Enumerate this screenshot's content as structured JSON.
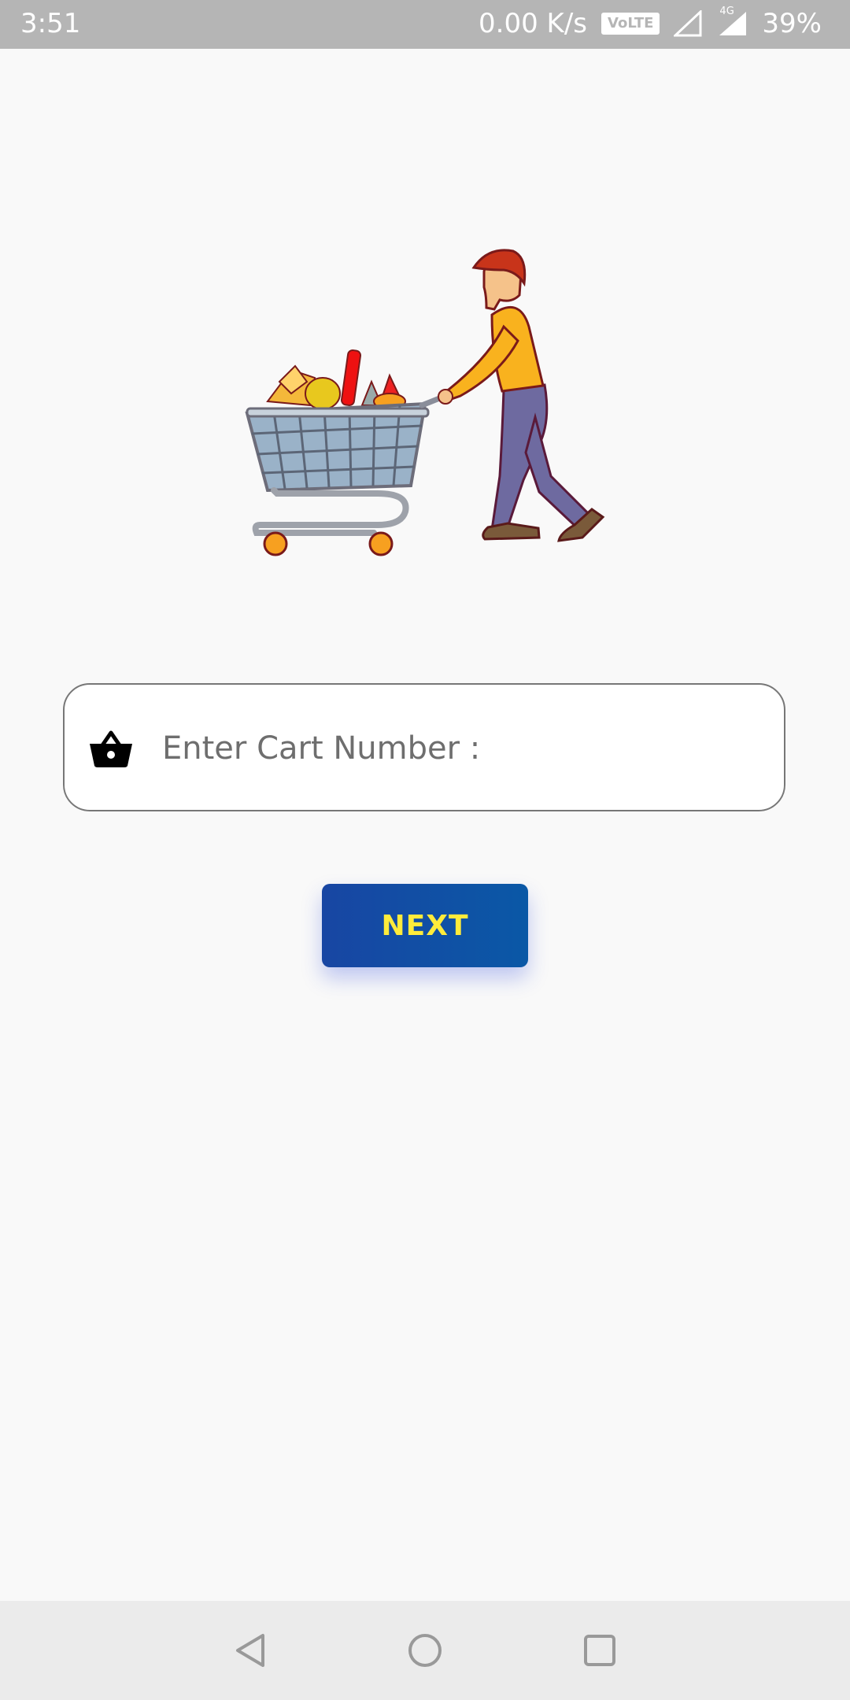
{
  "status_bar": {
    "time": "3:51",
    "network_speed": "0.00 K/s",
    "volte": "VoLTE",
    "network_type": "4G",
    "battery": "39%"
  },
  "illustration": {
    "icon": "shopper-with-cart-illustration"
  },
  "cart_field": {
    "icon": "shopping-basket-icon",
    "placeholder": "Enter Cart Number :",
    "value": ""
  },
  "next_button": {
    "label": "NEXT",
    "text_color": "#ffeb3b",
    "background_color": "#0f4fa5"
  },
  "nav_bar": {
    "back_icon": "back-triangle-icon",
    "home_icon": "home-circle-icon",
    "recents_icon": "recents-square-icon"
  }
}
